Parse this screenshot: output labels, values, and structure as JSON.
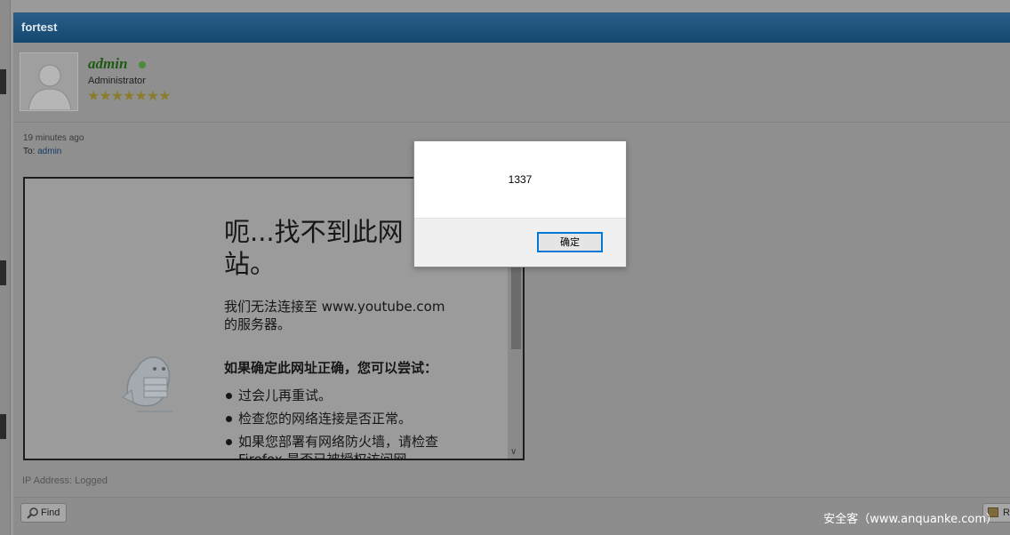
{
  "thread": {
    "title": "fortest"
  },
  "author": {
    "name": "admin",
    "role": "Administrator",
    "stars": "★★★★★★★"
  },
  "post": {
    "time": "19 minutes ago",
    "to_label": "To:",
    "to_user": "admin",
    "ip_label": "IP Address:",
    "ip_value": "Logged"
  },
  "iframe_page": {
    "title": "呃...找不到此网站。",
    "description": "我们无法连接至 www.youtube.com 的服务器。",
    "subtitle": "如果确定此网址正确，您可以尝试：",
    "tips": [
      "过会儿再重试。",
      "检查您的网络连接是否正常。",
      "如果您部署有网络防火墙，请检查 Firefox 是否已被授权访问网"
    ]
  },
  "buttons": {
    "find": "Find",
    "reply": "R"
  },
  "dialog": {
    "message": "1337",
    "ok": "确定"
  },
  "watermark": "安全客（www.anquanke.com）",
  "colors": {
    "header": "#15476e",
    "username": "#1f5a14",
    "online": "#4a8a3a",
    "ok_border": "#0078d7"
  }
}
